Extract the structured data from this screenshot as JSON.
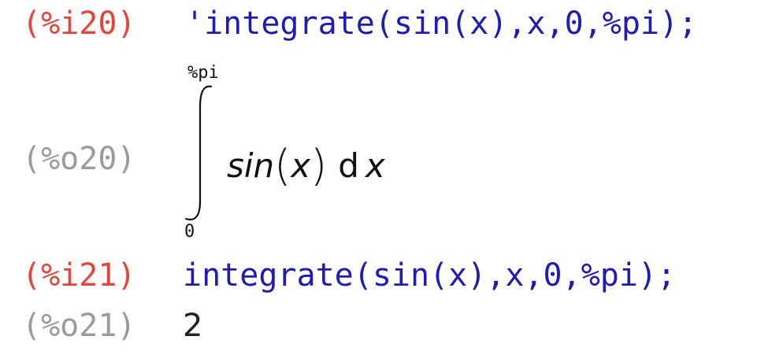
{
  "session": {
    "cells": [
      {
        "input_label": "(%i20)",
        "input_code": "'integrate(sin(x),x,0,%pi);",
        "output_label": "(%o20)",
        "output": {
          "integral_upper": "%pi",
          "integral_lower": "0",
          "integrand_fn": "sin",
          "integrand_arg": "x",
          "differential": "d",
          "variable": "x"
        }
      },
      {
        "input_label": "(%i21)",
        "input_code": "integrate(sin(x),x,0,%pi);",
        "output_label": "(%o21)",
        "output_value": "2"
      }
    ]
  },
  "colors": {
    "input_label": "#e8433b",
    "output_label": "#9b9b9b",
    "code": "#1e1bb7",
    "result": "#222222"
  },
  "icons": {
    "integral": "integral-sign-icon"
  }
}
